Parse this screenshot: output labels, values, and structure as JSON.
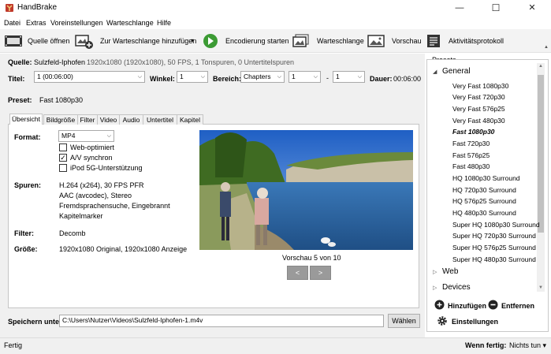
{
  "window": {
    "title": "HandBrake",
    "controls": [
      "—",
      "☐",
      "✕"
    ]
  },
  "menu": [
    "Datei",
    "Extras",
    "Voreinstellungen",
    "Warteschlange",
    "Hilfe"
  ],
  "toolbar": {
    "open_source": "Quelle öffnen",
    "add_to_queue": "Zur Warteschlange hinzufügen",
    "start_encode": "Encodierung starten",
    "queue": "Warteschlange",
    "preview": "Vorschau",
    "activity_log": "Aktivitätsprotokoll",
    "collapse_glyph": "▲"
  },
  "source": {
    "label": "Quelle:",
    "name": "Sulzfeld-Iphofen",
    "details": "1920x1080 (1920x1080), 50 FPS, 1 Tonspuren, 0 Untertitelspuren"
  },
  "title_row": {
    "title_label": "Titel:",
    "title_value": "1 (00:06:00)",
    "angle_label": "Winkel:",
    "angle_value": "1",
    "range_label": "Bereich:",
    "range_type": "Chapters",
    "range_start": "1",
    "range_sep": "-",
    "range_end": "1",
    "duration_label": "Dauer:",
    "duration_value": "00:06:00"
  },
  "preset_row": {
    "label": "Preset:",
    "value": "Fast 1080p30"
  },
  "tabs": [
    "Übersicht",
    "Bildgröße",
    "Filter",
    "Video",
    "Audio",
    "Untertitel",
    "Kapitel"
  ],
  "summary": {
    "format_label": "Format:",
    "format_value": "MP4",
    "web_optimized": {
      "label": "Web-optimiert",
      "checked": false
    },
    "av_sync": {
      "label": "A/V synchron",
      "checked": true
    },
    "ipod": {
      "label": "iPod 5G-Unterstützung",
      "checked": false
    },
    "tracks_label": "Spuren:",
    "tracks": [
      "H.264 (x264), 30 FPS PFR",
      "AAC (avcodec), Stereo",
      "Fremdsprachensuche, Eingebrannt",
      "Kapitelmarker"
    ],
    "filter_label": "Filter:",
    "filter_value": "Decomb",
    "size_label": "Größe:",
    "size_value": "1920x1080 Original, 1920x1080 Anzeige",
    "preview_caption": "Vorschau 5 von 10",
    "prev_btn": "<",
    "next_btn": ">"
  },
  "save": {
    "label": "Speichern unter:",
    "path": "C:\\Users\\Nutzer\\Videos\\Sulzfeld-Iphofen-1.m4v",
    "browse": "Wählen"
  },
  "presets": {
    "header": "Presets",
    "groups": [
      {
        "name": "General",
        "expanded": true,
        "glyph": "◢",
        "items": [
          "Very Fast 1080p30",
          "Very Fast 720p30",
          "Very Fast 576p25",
          "Very Fast 480p30",
          "Fast 1080p30",
          "Fast 720p30",
          "Fast 576p25",
          "Fast 480p30",
          "HQ 1080p30 Surround",
          "HQ 720p30 Surround",
          "HQ 576p25 Surround",
          "HQ 480p30 Surround",
          "Super HQ 1080p30 Surround",
          "Super HQ 720p30 Surround",
          "Super HQ 576p25 Surround",
          "Super HQ 480p30 Surround"
        ]
      },
      {
        "name": "Web",
        "expanded": false,
        "glyph": "▷"
      },
      {
        "name": "Devices",
        "expanded": false,
        "glyph": "▷"
      }
    ],
    "selected": "Fast 1080p30",
    "add_btn": "Hinzufügen",
    "remove_btn": "Entfernen",
    "settings_btn": "Einstellungen"
  },
  "status": {
    "text": "Fertig",
    "when_done_label": "Wenn fertig:",
    "when_done_value": "Nichts tun"
  },
  "colors": {
    "accent_green": "#3c9b34",
    "app_red": "#c0392b"
  }
}
